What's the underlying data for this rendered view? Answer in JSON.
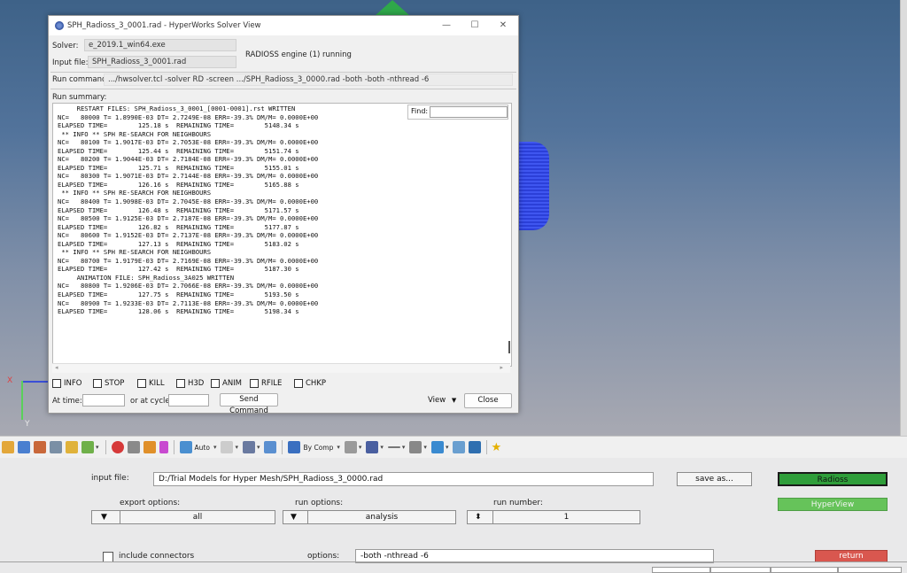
{
  "solver_window": {
    "title": "SPH_Radioss_3_0001.rad - HyperWorks Solver View",
    "solver_label": "Solver:",
    "solver_value": "e_2019.1_win64.exe",
    "input_label": "Input file:",
    "input_value": "SPH_Radioss_3_0001.rad",
    "status": "RADIOSS engine (1) running",
    "run_command_label": "Run command:",
    "run_command_value": ".../hwsolver.tcl -solver RD -screen .../SPH_Radioss_3_0000.rad -both -both -nthread -6",
    "run_summary_label": "Run summary:",
    "find_label": "Find:",
    "log_lines": [
      "     RESTART FILES: SPH_Radioss_3_0001_[0001-0001].rst WRITTEN",
      "NC=   80000 T= 1.8990E-03 DT= 2.7249E-08 ERR=-39.3% DM/M= 0.0000E+00",
      "ELAPSED TIME=        125.18 s  REMAINING TIME=        5148.34 s",
      " ** INFO ** SPH RE-SEARCH FOR NEIGHBOURS",
      "NC=   80100 T= 1.9017E-03 DT= 2.7053E-08 ERR=-39.3% DM/M= 0.0000E+00",
      "ELAPSED TIME=        125.44 s  REMAINING TIME=        5151.74 s",
      "NC=   80200 T= 1.9044E-03 DT= 2.7184E-08 ERR=-39.3% DM/M= 0.0000E+00",
      "ELAPSED TIME=        125.71 s  REMAINING TIME=        5155.01 s",
      "NC=   80300 T= 1.9071E-03 DT= 2.7144E-08 ERR=-39.3% DM/M= 0.0000E+00",
      "ELAPSED TIME=        126.16 s  REMAINING TIME=        5165.88 s",
      " ** INFO ** SPH RE-SEARCH FOR NEIGHBOURS",
      "NC=   80400 T= 1.9098E-03 DT= 2.7045E-08 ERR=-39.3% DM/M= 0.0000E+00",
      "ELAPSED TIME=        126.48 s  REMAINING TIME=        5171.57 s",
      "NC=   80500 T= 1.9125E-03 DT= 2.7187E-08 ERR=-39.3% DM/M= 0.0000E+00",
      "ELAPSED TIME=        126.82 s  REMAINING TIME=        5177.87 s",
      "NC=   80600 T= 1.9152E-03 DT= 2.7137E-08 ERR=-39.3% DM/M= 0.0000E+00",
      "ELAPSED TIME=        127.13 s  REMAINING TIME=        5183.02 s",
      " ** INFO ** SPH RE-SEARCH FOR NEIGHBOURS",
      "NC=   80700 T= 1.9179E-03 DT= 2.7169E-08 ERR=-39.3% DM/M= 0.0000E+00",
      "ELAPSED TIME=        127.42 s  REMAINING TIME=        5187.30 s",
      "     ANIMATION FILE: SPH_Radioss_3A025 WRITTEN",
      "NC=   80800 T= 1.9206E-03 DT= 2.7066E-08 ERR=-39.3% DM/M= 0.0000E+00",
      "ELAPSED TIME=        127.75 s  REMAINING TIME=        5193.50 s",
      "NC=   80900 T= 1.9233E-03 DT= 2.7113E-08 ERR=-39.3% DM/M= 0.0000E+00",
      "ELAPSED TIME=        128.06 s  REMAINING TIME=        5198.34 s"
    ],
    "checkboxes": [
      "INFO",
      "STOP",
      "KILL",
      "H3D",
      "ANIM",
      "RFILE",
      "CHKP"
    ],
    "at_time_label": "At time:",
    "at_cycle_label": "or at cycle:",
    "send_command": "Send Command",
    "view_label": "View",
    "close_label": "Close",
    "min_glyph": "—",
    "max_glyph": "☐",
    "close_glyph": "✕"
  },
  "viewport": {
    "axis_x": "X",
    "axis_y": "Y"
  },
  "toolbar": {
    "auto_label": "Auto",
    "bycomp_label": "By Comp"
  },
  "panel": {
    "input_file_label": "input file:",
    "input_file_value": "D:/Trial Models for Hyper Mesh/SPH_Radioss_3_0000.rad",
    "save_as": "save as...",
    "radioss": "Radioss",
    "hyperview": "HyperView",
    "export_options_label": "export options:",
    "export_options_value": "all",
    "run_options_label": "run options:",
    "run_options_value": "analysis",
    "run_number_label": "run number:",
    "run_number_value": "1",
    "include_connectors": "include connectors",
    "options_label": "options:",
    "options_value": "-both -nthread -6",
    "return": "return"
  },
  "colors": {
    "accent_green": "#2f9e3a",
    "hyperview_green": "#66c35a",
    "return_red": "#d9574f"
  }
}
